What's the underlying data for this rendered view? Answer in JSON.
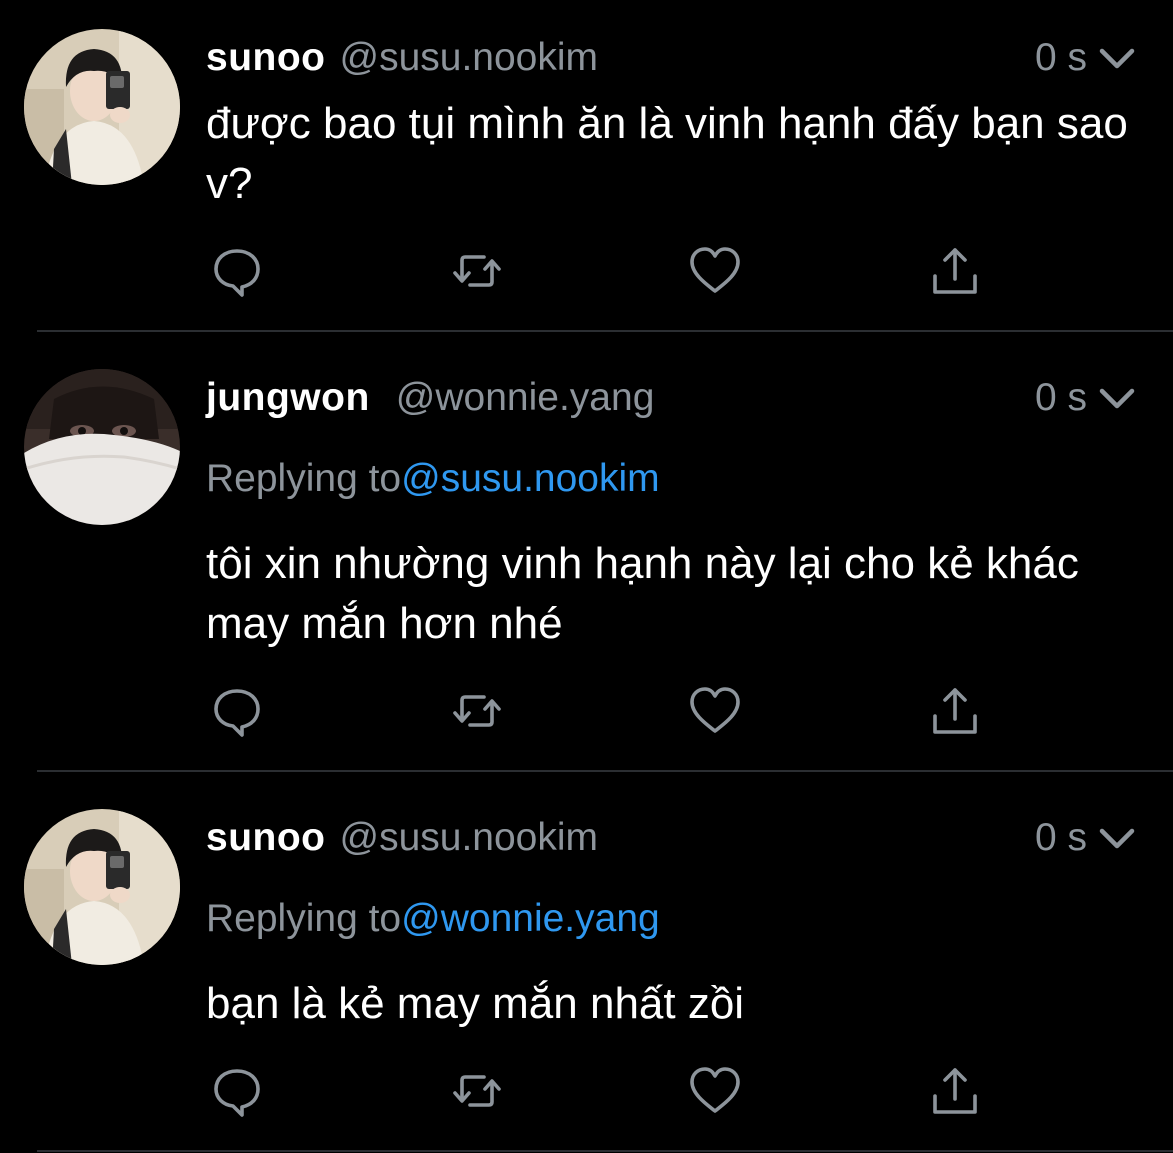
{
  "tweets": [
    {
      "display_name": "sunoo",
      "handle": "@susu.nookim",
      "time": "0 s",
      "replying_prefix": "",
      "replying_to": "",
      "text": "được bao tụi mình ăn là vinh hạnh đấy bạn sao v?"
    },
    {
      "display_name": "jungwon",
      "handle": "@wonnie.yang",
      "time": "0 s",
      "replying_prefix": "Replying to",
      "replying_to": "@susu.nookim",
      "text": "tôi xin nhường vinh hạnh này lại cho kẻ khác may mắn hơn nhé"
    },
    {
      "display_name": "sunoo",
      "handle": "@susu.nookim",
      "time": "0 s",
      "replying_prefix": "Replying to",
      "replying_to": "@wonnie.yang",
      "text": "bạn là kẻ may mắn nhất zồi"
    }
  ],
  "icons": {
    "reply": "comment-bubble-icon",
    "retweet": "retweet-icon",
    "like": "heart-icon",
    "share": "share-upload-icon",
    "menu": "chevron-down-icon"
  },
  "colors": {
    "background": "#000000",
    "text": "#ffffff",
    "muted": "#8d949b",
    "link": "#2f98f0",
    "divider": "#2b2e32"
  }
}
